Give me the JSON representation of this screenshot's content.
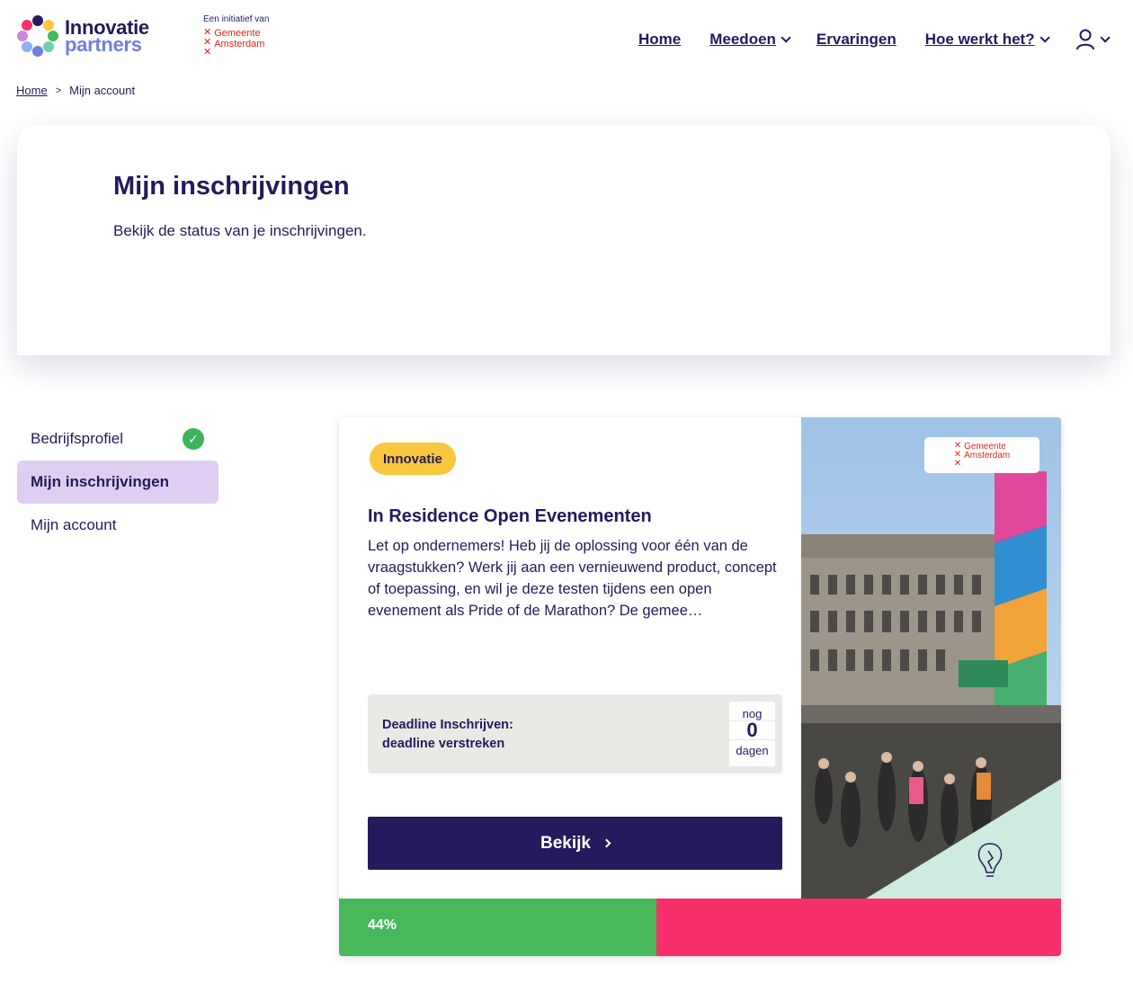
{
  "header": {
    "logo_line1": "Innovatie",
    "logo_line2": "partners",
    "initiative_label": "Een initiatief van",
    "municipality_line1": "Gemeente",
    "municipality_line2": "Amsterdam",
    "nav": {
      "home": "Home",
      "meedoen": "Meedoen",
      "ervaringen": "Ervaringen",
      "hoe_werkt_het": "Hoe werkt het?"
    },
    "user_icon": "user-icon"
  },
  "breadcrumb": {
    "home": "Home",
    "separator": ">",
    "current": "Mijn account"
  },
  "hero": {
    "title": "Mijn inschrijvingen",
    "subtitle": "Bekijk de status van je inschrijvingen."
  },
  "sidebar": {
    "items": [
      {
        "label": "Bedrijfsprofiel",
        "complete": true
      },
      {
        "label": "Mijn inschrijvingen",
        "active": true
      },
      {
        "label": "Mijn account"
      }
    ]
  },
  "card": {
    "tag": "Innovatie",
    "title": "In Residence Open Evenementen",
    "description": "Let op ondernemers! Heb jij de oplossing voor één van de vraagstukken? Werk jij aan een vernieuwend product, concept of toepassing, en wil je deze testen tijdens een open evenement als Pride of de Marathon? De gemee…",
    "deadline_label": "Deadline Inschrijven:",
    "deadline_status": "deadline verstreken",
    "countdown_prefix": "nog",
    "countdown_value": "0",
    "countdown_suffix": "dagen",
    "button_label": "Bekijk",
    "image_badge_line1": "Gemeente",
    "image_badge_line2": "Amsterdam",
    "progress_fraction": 0.44,
    "progress_label": "44%"
  },
  "colors": {
    "navy": "#231b5c",
    "tag_yellow": "#f9c83f",
    "active_lilac": "#e0cef2",
    "progress_green": "#48b85c",
    "progress_pink": "#f7306b",
    "check_green": "#3fb45a",
    "amsterdam_red": "#e0261b"
  }
}
